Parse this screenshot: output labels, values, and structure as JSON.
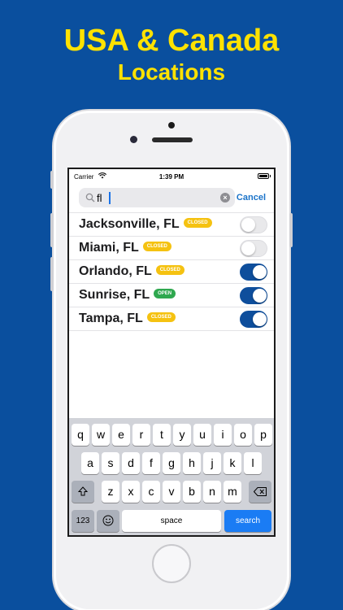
{
  "promo": {
    "title": "USA & Canada",
    "subtitle": "Locations"
  },
  "status_bar": {
    "carrier": "Carrier",
    "time": "1:39 PM"
  },
  "search": {
    "value": "fl",
    "cancel_label": "Cancel"
  },
  "locations": [
    {
      "name": "Jacksonville, FL",
      "status": "CLOSED",
      "enabled": false
    },
    {
      "name": "Miami, FL",
      "status": "CLOSED",
      "enabled": false
    },
    {
      "name": "Orlando, FL",
      "status": "CLOSED",
      "enabled": true
    },
    {
      "name": "Sunrise, FL",
      "status": "OPEN",
      "enabled": true
    },
    {
      "name": "Tampa, FL",
      "status": "CLOSED",
      "enabled": true
    }
  ],
  "keyboard": {
    "row1": [
      "q",
      "w",
      "e",
      "r",
      "t",
      "y",
      "u",
      "i",
      "o",
      "p"
    ],
    "row2": [
      "a",
      "s",
      "d",
      "f",
      "g",
      "h",
      "j",
      "k",
      "l"
    ],
    "row3": [
      "z",
      "x",
      "c",
      "v",
      "b",
      "n",
      "m"
    ],
    "numbers_label": "123",
    "space_label": "space",
    "search_label": "search"
  },
  "colors": {
    "background": "#0a4f9e",
    "headline": "#ffe200",
    "toggle_on": "#0e4e9c",
    "badge_closed": "#f5c211",
    "badge_open": "#2fa84f"
  },
  "icons": [
    "wifi-icon",
    "battery-icon",
    "search-icon",
    "clear-icon",
    "shift-icon",
    "backspace-icon",
    "emoji-icon"
  ]
}
